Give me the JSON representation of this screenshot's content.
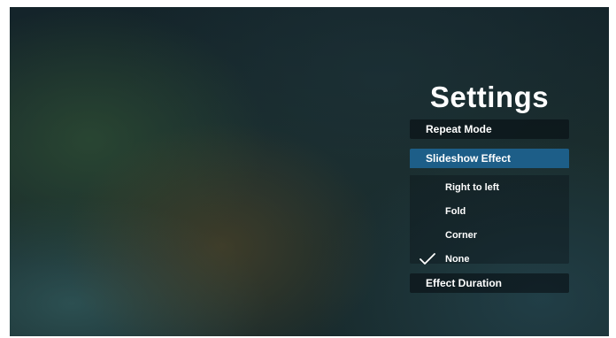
{
  "settings": {
    "title": "Settings",
    "repeat_mode": "Repeat Mode",
    "slideshow_effect": "Slideshow Effect",
    "effect_options": [
      "Right to left",
      "Fold",
      "Corner",
      "None"
    ],
    "selected_option": "None",
    "effect_duration": "Effect Duration"
  },
  "colors": {
    "selected_bg": "#1d5e88",
    "text": "#ffffff"
  },
  "icons": {
    "selected_marker": "checkmark-icon"
  }
}
